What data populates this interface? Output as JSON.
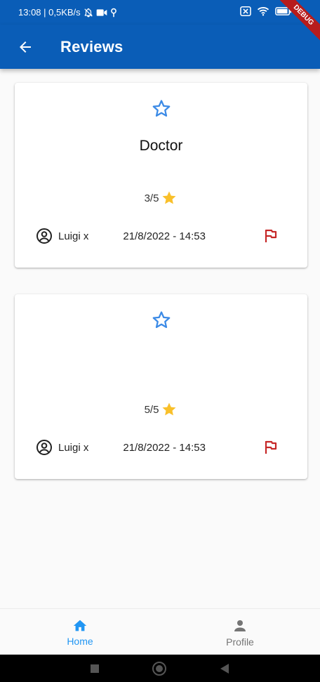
{
  "status_bar": {
    "time_info": "13:08 | 0,5KB/s"
  },
  "app_bar": {
    "title": "Reviews",
    "debug_label": "DEBUG"
  },
  "reviews": [
    {
      "title": "Doctor",
      "rating": "3/5",
      "user": "Luigi x",
      "date": "21/8/2022 - 14:53"
    },
    {
      "title": "",
      "rating": "5/5",
      "user": "Luigi x",
      "date": "21/8/2022 - 14:53"
    }
  ],
  "bottom_nav": {
    "home_label": "Home",
    "profile_label": "Profile"
  },
  "colors": {
    "app_bar": "#0a5db7",
    "accent": "#2196f3",
    "star_outline": "#3b8ae6",
    "star_fill": "#f9c02a",
    "flag": "#c62828"
  },
  "icons": {
    "back": "arrow-left-icon",
    "header_star": "star-outline-icon",
    "rating_star": "star-filled-icon",
    "user": "account-circle-icon",
    "flag": "flag-icon",
    "home": "home-icon",
    "profile": "person-icon"
  }
}
